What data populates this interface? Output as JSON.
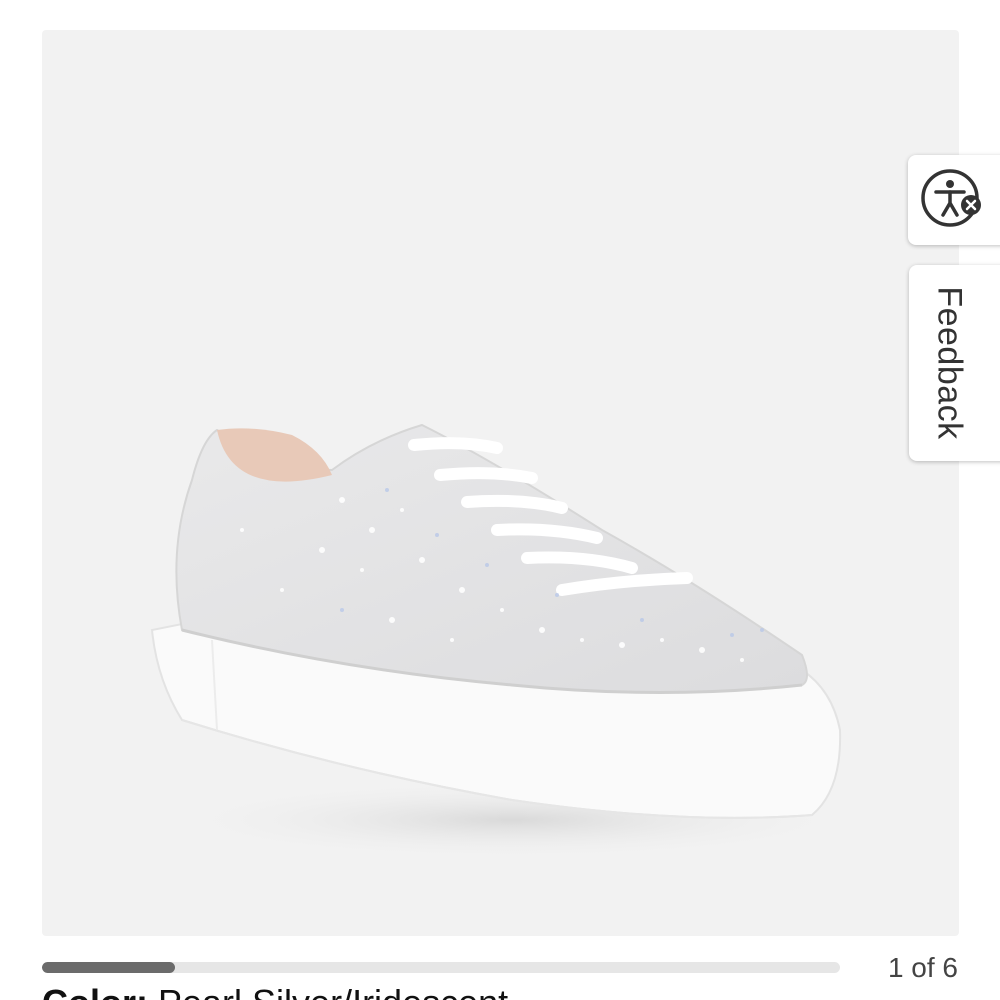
{
  "gallery": {
    "image_alt": "Pearl Silver/Iridescent rhinestone platform sneaker",
    "counter": "1 of 6",
    "current_index": 1,
    "total_images": 6
  },
  "widgets": {
    "accessibility_icon": "accessibility-person-icon",
    "feedback_label": "Feedback"
  },
  "product": {
    "color_label": "Color:",
    "color_value": "Pearl Silver/Iridescent"
  },
  "colors": {
    "image_background": "#f2f2f2",
    "progress_fill": "#6b6b6b",
    "progress_track": "#e6e6e6"
  }
}
